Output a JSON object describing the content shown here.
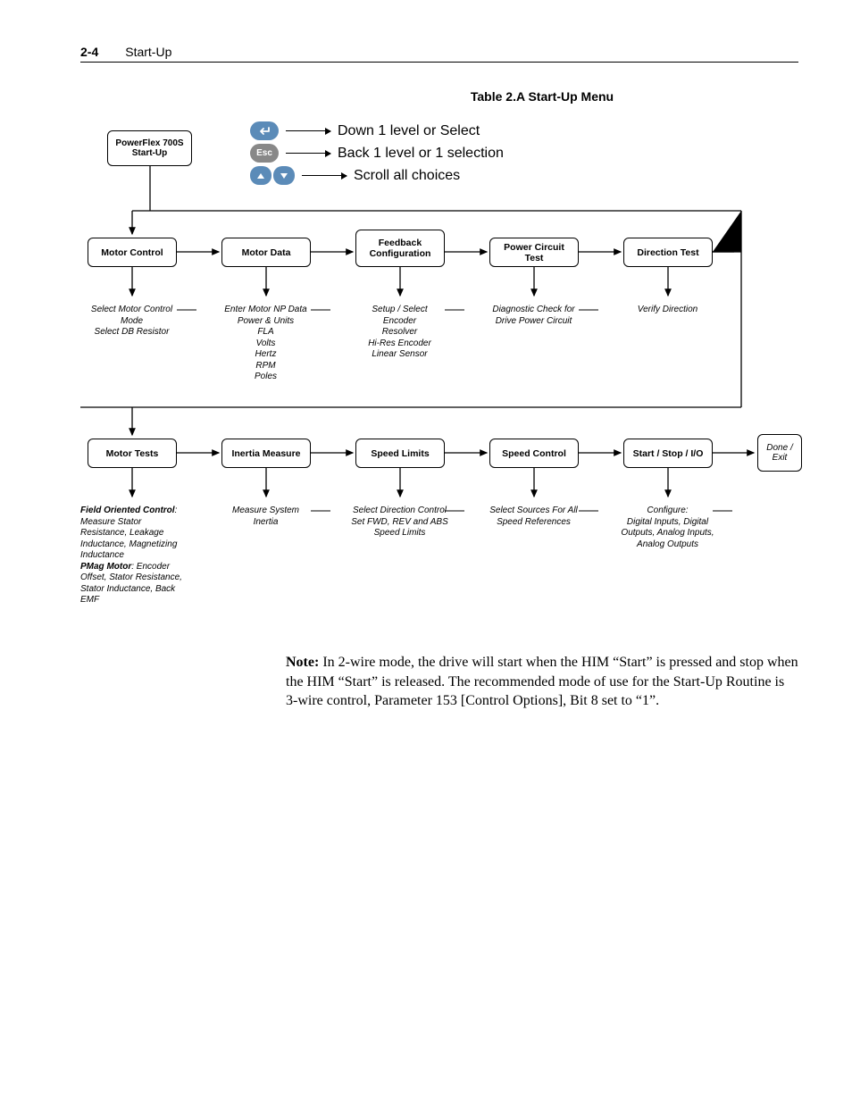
{
  "header": {
    "page_num": "2-4",
    "title": "Start-Up"
  },
  "table_title": "Table 2.A   Start-Up Menu",
  "legend": {
    "enter": "Down 1 level or Select",
    "esc_label": "Esc",
    "esc": "Back 1 level or 1 selection",
    "scroll": "Scroll all choices"
  },
  "nodes": {
    "start": "PowerFlex 700S\nStart-Up",
    "r1": [
      "Motor Control",
      "Motor Data",
      "Feedback Configuration",
      "Power Circuit Test",
      "Direction Test"
    ],
    "r1_desc": [
      "Select Motor Control Mode\nSelect DB Resistor",
      "Enter Motor NP Data\nPower & Units\nFLA\nVolts\nHertz\nRPM\nPoles",
      "Setup / Select\nEncoder\nResolver\nHi-Res Encoder\nLinear Sensor",
      "Diagnostic Check for Drive Power Circuit",
      "Verify Direction"
    ],
    "r2": [
      "Motor Tests",
      "Inertia Measure",
      "Speed Limits",
      "Speed Control",
      "Start / Stop / I/O",
      "Done / Exit"
    ],
    "r2_desc": [
      {
        "bold1": "Field Oriented Control",
        "t1": ": Measure Stator Resistance, Leakage Inductance, Magnetizing Inductance",
        "bold2": "PMag Motor",
        "t2": ": Encoder Offset, Stator Resistance, Stator Inductance, Back EMF"
      },
      "Measure System Inertia",
      "Select Direction Control\nSet FWD, REV and ABS Speed Limits",
      "Select Sources For All Speed References",
      "Configure:\nDigital Inputs, Digital Outputs, Analog Inputs, Analog Outputs"
    ]
  },
  "note": {
    "label": "Note:",
    "text": " In 2-wire mode, the drive will start when the HIM “Start” is pressed and stop when the HIM “Start” is released. The recommended mode of use for the Start-Up Routine is 3-wire control, Parameter 153 [Control Options], Bit 8 set to “1”."
  }
}
